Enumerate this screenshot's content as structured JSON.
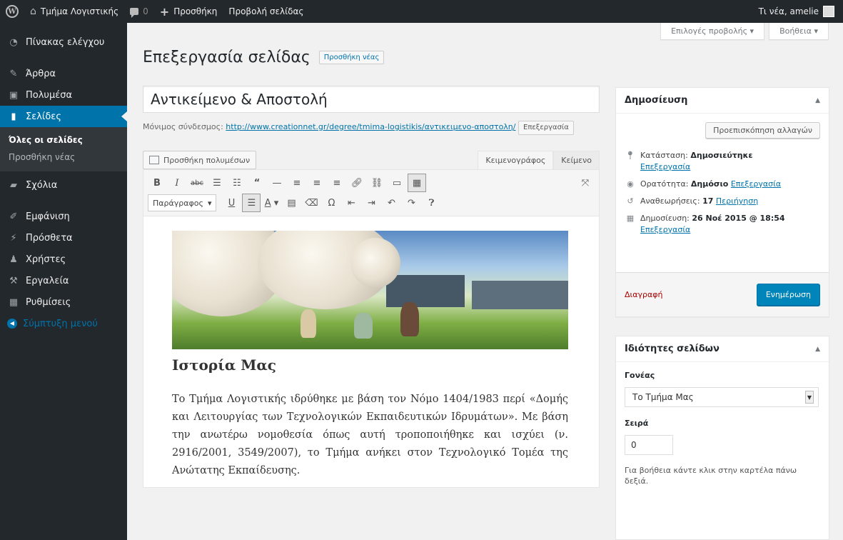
{
  "adminbar": {
    "site_name": "Τμήμα Λογιστικής",
    "comments_count": "0",
    "new_label": "Προσθήκη",
    "view_page_label": "Προβολή σελίδας",
    "greeting": "Τι νέα, amelie"
  },
  "sidebar": {
    "items": [
      {
        "label": "Πίνακας ελέγχου",
        "icon": "dashboard-icon"
      },
      {
        "label": "Άρθρα",
        "icon": "pin-icon"
      },
      {
        "label": "Πολυμέσα",
        "icon": "media-icon"
      },
      {
        "label": "Σελίδες",
        "icon": "page-icon"
      },
      {
        "label": "Σχόλια",
        "icon": "comment-icon"
      },
      {
        "label": "Εμφάνιση",
        "icon": "brush-icon"
      },
      {
        "label": "Πρόσθετα",
        "icon": "plugin-icon"
      },
      {
        "label": "Χρήστες",
        "icon": "user-icon"
      },
      {
        "label": "Εργαλεία",
        "icon": "wrench-icon"
      },
      {
        "label": "Ρυθμίσεις",
        "icon": "settings-icon"
      },
      {
        "label": "Σύμπτυξη μενού",
        "icon": "collapse-icon"
      }
    ],
    "submenu": [
      "Όλες οι σελίδες",
      "Προσθήκη νέας"
    ]
  },
  "screen_meta": {
    "screen_options": "Επιλογές προβολής",
    "help": "Βοήθεια"
  },
  "main": {
    "heading": "Επεξεργασία σελίδας",
    "add_new": "Προσθήκη νέας",
    "title_value": "Αντικείμενο & Αποστολή",
    "permalink_label": "Μόνιμος σύνδεσμος:",
    "permalink_url": "http://www.creationnet.gr/degree/tmima-logistikis/αντικειμενο-αποστολη/",
    "permalink_edit": "Επεξεργασία",
    "add_media": "Προσθήκη πολυμέσων",
    "tab_visual": "Κειμενογράφος",
    "tab_text": "Κείμενο",
    "format_select": "Παράγραφος",
    "content_heading": "Ιστορία Μας",
    "content_paragraph": "Το Τμήμα Λογιστικής ιδρύθηκε με βάση τον Νόμο 1404/1983 περί «Δομής και Λειτουργίας των Τεχνολογικών Εκπαιδευτικών Ιδρυμάτων». Με βάση την ανωτέρω νομοθεσία όπως αυτή τροποποιήθηκε και ισχύει (ν. 2916/2001, 3549/2007), το Τμήμα ανήκει στον Τεχνολογικό Τομέα της Ανώτατης Εκπαίδευσης."
  },
  "publish": {
    "title": "Δημοσίευση",
    "preview_btn": "Προεπισκόπηση αλλαγών",
    "status_label": "Κατάσταση:",
    "status_value": "Δημοσιεύτηκε",
    "status_edit": "Επεξεργασία",
    "visibility_label": "Ορατότητα:",
    "visibility_value": "Δημόσιο",
    "visibility_edit": "Επεξεργασία",
    "revisions_label": "Αναθεωρήσεις:",
    "revisions_value": "17",
    "revisions_link": "Περιήγηση",
    "published_label": "Δημοσίευση:",
    "published_value": "26 Νοέ 2015 @ 18:54",
    "published_edit": "Επεξεργασία",
    "delete_label": "Διαγραφή",
    "update_btn": "Ενημέρωση"
  },
  "attributes": {
    "title": "Ιδιότητες σελίδων",
    "parent_label": "Γονέας",
    "parent_value": "Το Τμήμα Μας",
    "order_label": "Σειρά",
    "order_value": "0",
    "help_text": "Για βοήθεια κάντε κλικ στην καρτέλα πάνω δεξιά."
  },
  "colors": {
    "admin_dark": "#23282d",
    "accent_blue": "#0073aa",
    "primary_button": "#0085ba",
    "delete_red": "#a00"
  }
}
